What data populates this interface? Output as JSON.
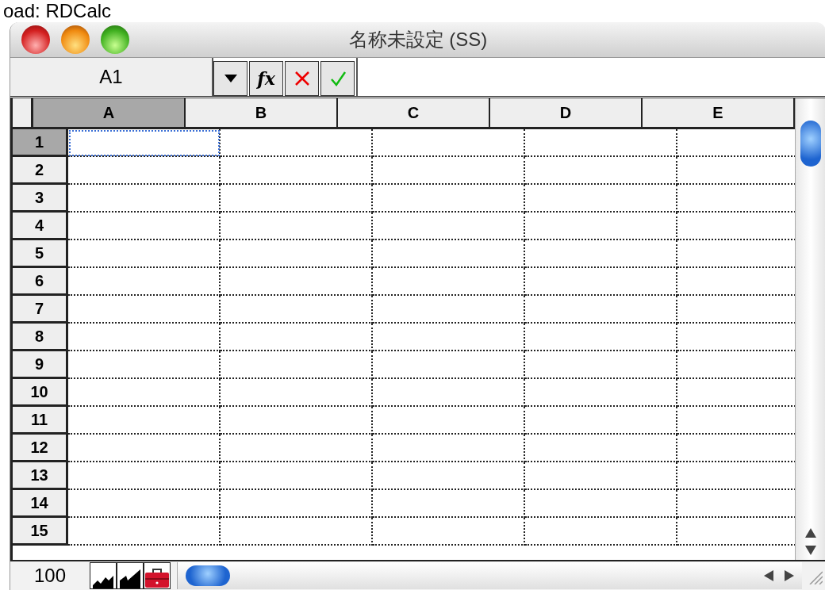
{
  "caption": "oad: RDCalc",
  "window": {
    "title": "名称未設定 (SS)"
  },
  "formula_bar": {
    "cell_reference": "A1",
    "function_button": "fx"
  },
  "columns": [
    {
      "label": "A",
      "selected": true
    },
    {
      "label": "B",
      "selected": false
    },
    {
      "label": "C",
      "selected": false
    },
    {
      "label": "D",
      "selected": false
    },
    {
      "label": "E",
      "selected": false
    }
  ],
  "rows": [
    {
      "label": "1",
      "selected": true
    },
    {
      "label": "2",
      "selected": false
    },
    {
      "label": "3",
      "selected": false
    },
    {
      "label": "4",
      "selected": false
    },
    {
      "label": "5",
      "selected": false
    },
    {
      "label": "6",
      "selected": false
    },
    {
      "label": "7",
      "selected": false
    },
    {
      "label": "8",
      "selected": false
    },
    {
      "label": "9",
      "selected": false
    },
    {
      "label": "10",
      "selected": false
    },
    {
      "label": "11",
      "selected": false
    },
    {
      "label": "12",
      "selected": false
    },
    {
      "label": "13",
      "selected": false
    },
    {
      "label": "14",
      "selected": false
    },
    {
      "label": "15",
      "selected": false
    }
  ],
  "status_bar": {
    "zoom": "100"
  }
}
